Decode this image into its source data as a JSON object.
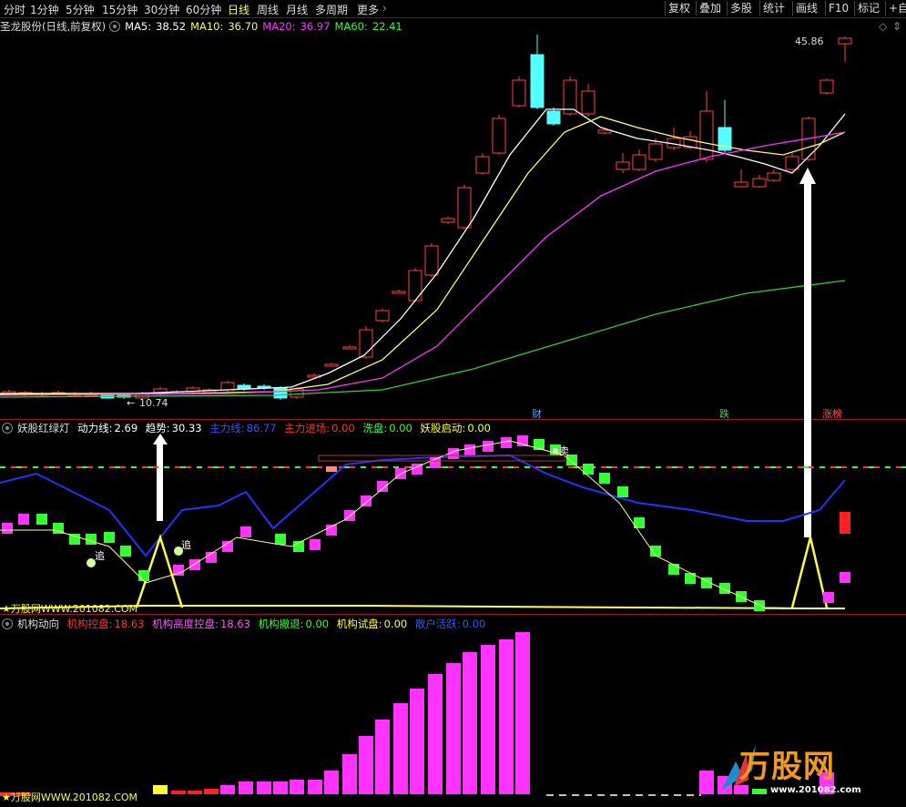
{
  "toolbar": {
    "tabs": [
      "分时",
      "1分钟",
      "5分钟",
      "15分钟",
      "30分钟",
      "60分钟",
      "日线",
      "周线",
      "月线",
      "多周期",
      "更多"
    ],
    "active_tab": "日线",
    "buttons": [
      "复权",
      "叠加",
      "多股",
      "统计",
      "画线",
      "F10",
      "标记",
      "+自"
    ]
  },
  "main": {
    "title": "圣龙股份(日线,前复权)",
    "ma": [
      {
        "label": "MA5:",
        "value": "38.52",
        "color": "#ffffff"
      },
      {
        "label": "MA10:",
        "value": "36.70",
        "color": "#ffff33"
      },
      {
        "label": "MA20:",
        "value": "36.97",
        "color": "#ff33ff"
      },
      {
        "label": "MA60:",
        "value": "22.41",
        "color": "#33ff33"
      }
    ],
    "high_label": "45.86",
    "low_label": "10.74",
    "tags": [
      {
        "text": "财",
        "color": "#55aaff"
      },
      {
        "text": "跌",
        "color": "#33dd33"
      },
      {
        "text": "涨榜",
        "color": "#ff5555"
      }
    ]
  },
  "panel2": {
    "title": "妖股红绿灯",
    "items": [
      {
        "label": "动力线:",
        "value": "2.69",
        "color": "#ffffff"
      },
      {
        "label": "趋势:",
        "value": "30.33",
        "color": "#ffffff"
      },
      {
        "label": "主力线:",
        "value": "86.77",
        "color": "#3355ff"
      },
      {
        "label": "主力进场:",
        "value": "0.00",
        "color": "#ff3333"
      },
      {
        "label": "洗盘:",
        "value": "0.00",
        "color": "#33ff33"
      },
      {
        "label": "妖股启动:",
        "value": "0.00",
        "color": "#ffff33"
      }
    ],
    "markers": [
      "追",
      "追",
      "卖"
    ],
    "watermark": "★万股网WWW.201082.COM"
  },
  "panel3": {
    "title": "机构动向",
    "items": [
      {
        "label": "机构控盘:",
        "value": "18.63",
        "color": "#ff3333"
      },
      {
        "label": "机构高度控盘:",
        "value": "18.63",
        "color": "#ff55ff"
      },
      {
        "label": "机构撤退:",
        "value": "0.00",
        "color": "#33ff33"
      },
      {
        "label": "机构试盘:",
        "value": "0.00",
        "color": "#ffff33"
      },
      {
        "label": "散户活跃:",
        "value": "0.00",
        "color": "#3355ff"
      }
    ],
    "watermark": "★万股网WWW.201082.COM"
  },
  "logo": {
    "text": "万股网",
    "url": "www.201082.com"
  }
}
